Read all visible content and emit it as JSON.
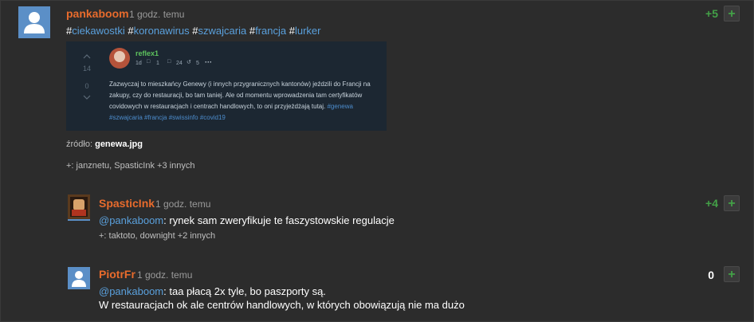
{
  "post": {
    "author": "pankaboom",
    "time": "1 godz. temu",
    "score": "+5",
    "plus": "+",
    "tags": [
      "ciekawostki",
      "koronawirus",
      "szwajcaria",
      "francja",
      "lurker"
    ],
    "embed": {
      "up_count": "14",
      "down_count": "0",
      "nick": "reflex1",
      "age": "1d",
      "comments": "1",
      "bookmarks": "24",
      "shares": "5",
      "text": "Zazwyczaj to mieszkańcy Genewy (i innych przygranicznych kantonów) jeździli do Francji na zakupy, czy do restauracji, bo tam taniej. Ale od momentu wprowadzenia tam certyfikatów covidowych w restauracjach i centrach handlowych, to oni przyjeżdżają tutaj.",
      "tags": "#genewa #szwajcaria #francja #swissinfo #covid19"
    },
    "source_label": "źródło:",
    "source_file": "genewa.jpg",
    "voters": "+: janznetu, SpasticInk +3 innych"
  },
  "comments": [
    {
      "author": "SpasticInk",
      "time": "1 godz. temu",
      "score": "+4",
      "plus": "+",
      "mention": "@pankaboom",
      "text": ": rynek sam zweryfikuje te faszystowskie regulacje",
      "voters": "+: taktoto, downight +2 innych"
    },
    {
      "author": "PiotrFr",
      "time": "1 godz. temu",
      "score": "0",
      "plus": "+",
      "mention": "@pankaboom",
      "text": ": taa płacą 2x tyle, bo paszporty są.",
      "text2": "W restauracjach ok ale centrów handlowych, w których obowiązują nie ma dużo"
    }
  ],
  "colors": {
    "background": "#2c2c2c",
    "username": "#e86b2c",
    "tag": "#5aa0dc",
    "positive": "#43a047"
  }
}
